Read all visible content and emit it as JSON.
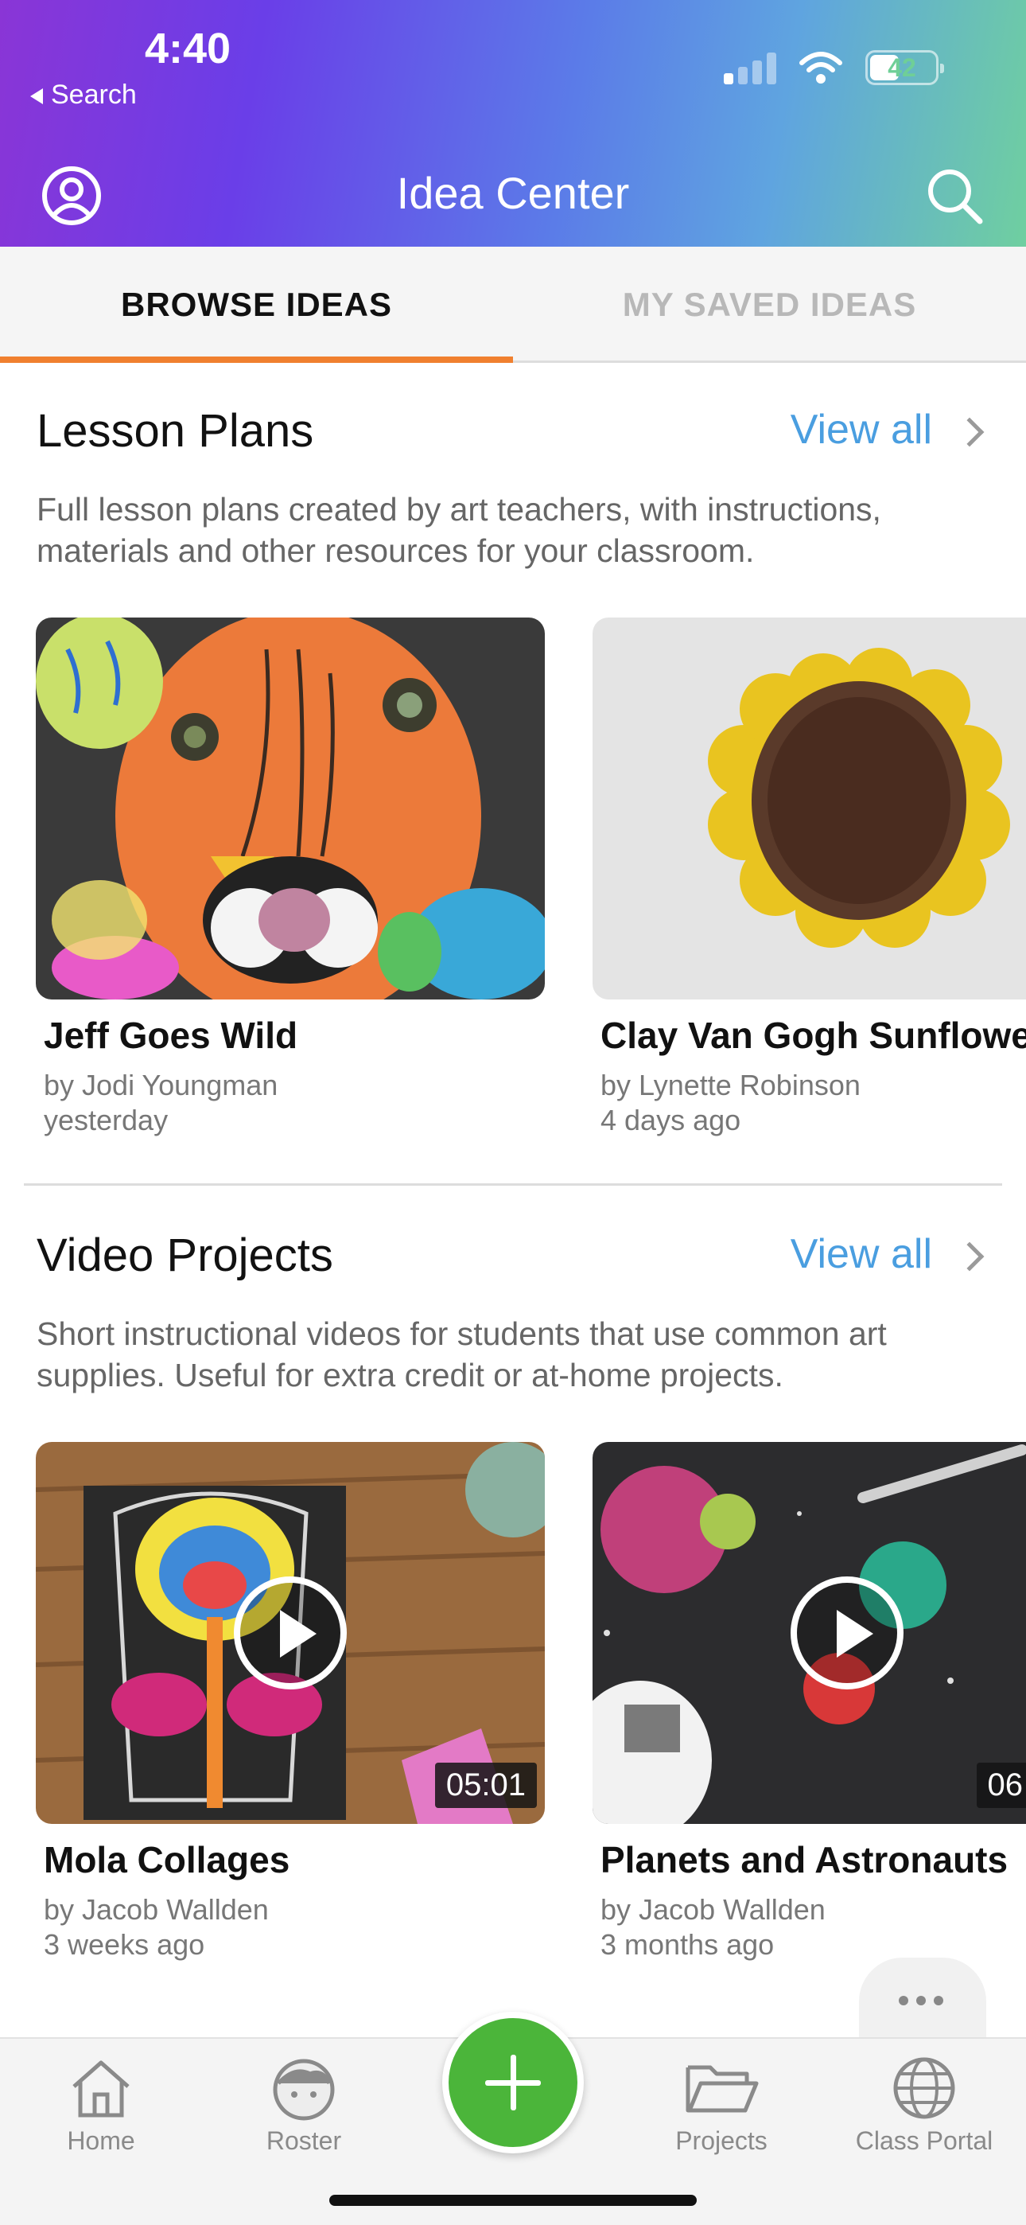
{
  "status_bar": {
    "time": "4:40",
    "back_label": "Search",
    "battery": "42"
  },
  "header": {
    "title": "Idea Center"
  },
  "tabs": [
    {
      "label": "BROWSE IDEAS",
      "active": true
    },
    {
      "label": "MY SAVED IDEAS",
      "active": false
    }
  ],
  "sections": [
    {
      "title": "Lesson Plans",
      "view_all": "View all",
      "description": "Full lesson plans created by art teachers, with instructions, materials and other resources for your classroom.",
      "cards": [
        {
          "title": "Jeff Goes Wild",
          "author": "by Jodi Youngman",
          "time": "yesterday"
        },
        {
          "title": "Clay Van Gogh Sunflower",
          "author": "by Lynette Robinson",
          "time": "4 days ago"
        }
      ]
    },
    {
      "title": "Video Projects",
      "view_all": "View all",
      "description": "Short instructional videos for students that use common art supplies. Useful for extra credit or at-home projects.",
      "cards": [
        {
          "title": "Mola Collages",
          "author": "by Jacob Wallden",
          "time": "3 weeks ago",
          "duration": "05:01"
        },
        {
          "title": "Planets and Astronauts",
          "author": "by Jacob Wallden",
          "time": "3 months ago",
          "duration": "06"
        }
      ]
    }
  ],
  "nav": [
    {
      "label": "Home",
      "icon": "home-icon"
    },
    {
      "label": "Roster",
      "icon": "face-icon"
    },
    {
      "label": "Projects",
      "icon": "folder-icon"
    },
    {
      "label": "Class Portal",
      "icon": "globe-icon"
    }
  ],
  "colors": {
    "accent_orange": "#f0802f",
    "link_blue": "#4a9ee0",
    "fab_green": "#4bb53a"
  }
}
